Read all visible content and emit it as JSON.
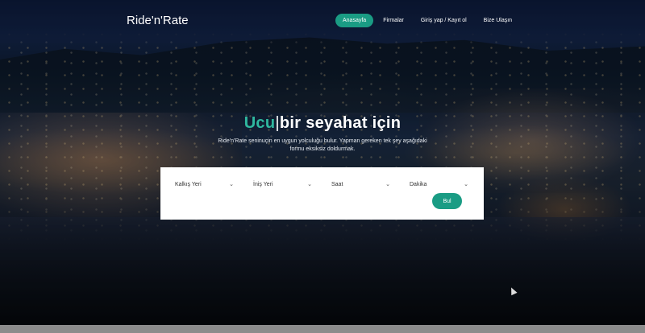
{
  "brand": "Ride'n'Rate",
  "nav": [
    {
      "label": "Anasayfa",
      "active": true
    },
    {
      "label": "Firmalar",
      "active": false
    },
    {
      "label": "Giriş yap / Kayıt ol",
      "active": false
    },
    {
      "label": "Bize Ulaşın",
      "active": false
    }
  ],
  "hero": {
    "title_accent": "Ucu",
    "title_caret": "|",
    "title_rest": "bir seyahat için",
    "subtitle": "Ride'n'Rate seninuçin en uygun yolculuğu bulur. Yapman gereken tek şey aşağıdaki formu eksiksiz doldurmak."
  },
  "search": {
    "departure": "Kalkış Yeri",
    "arrival": "İniş Yeri",
    "hour": "Saat",
    "minute": "Dakika",
    "submit": "Bul"
  },
  "colors": {
    "accent": "#1a9c84",
    "accent_text": "#2fb89f"
  }
}
